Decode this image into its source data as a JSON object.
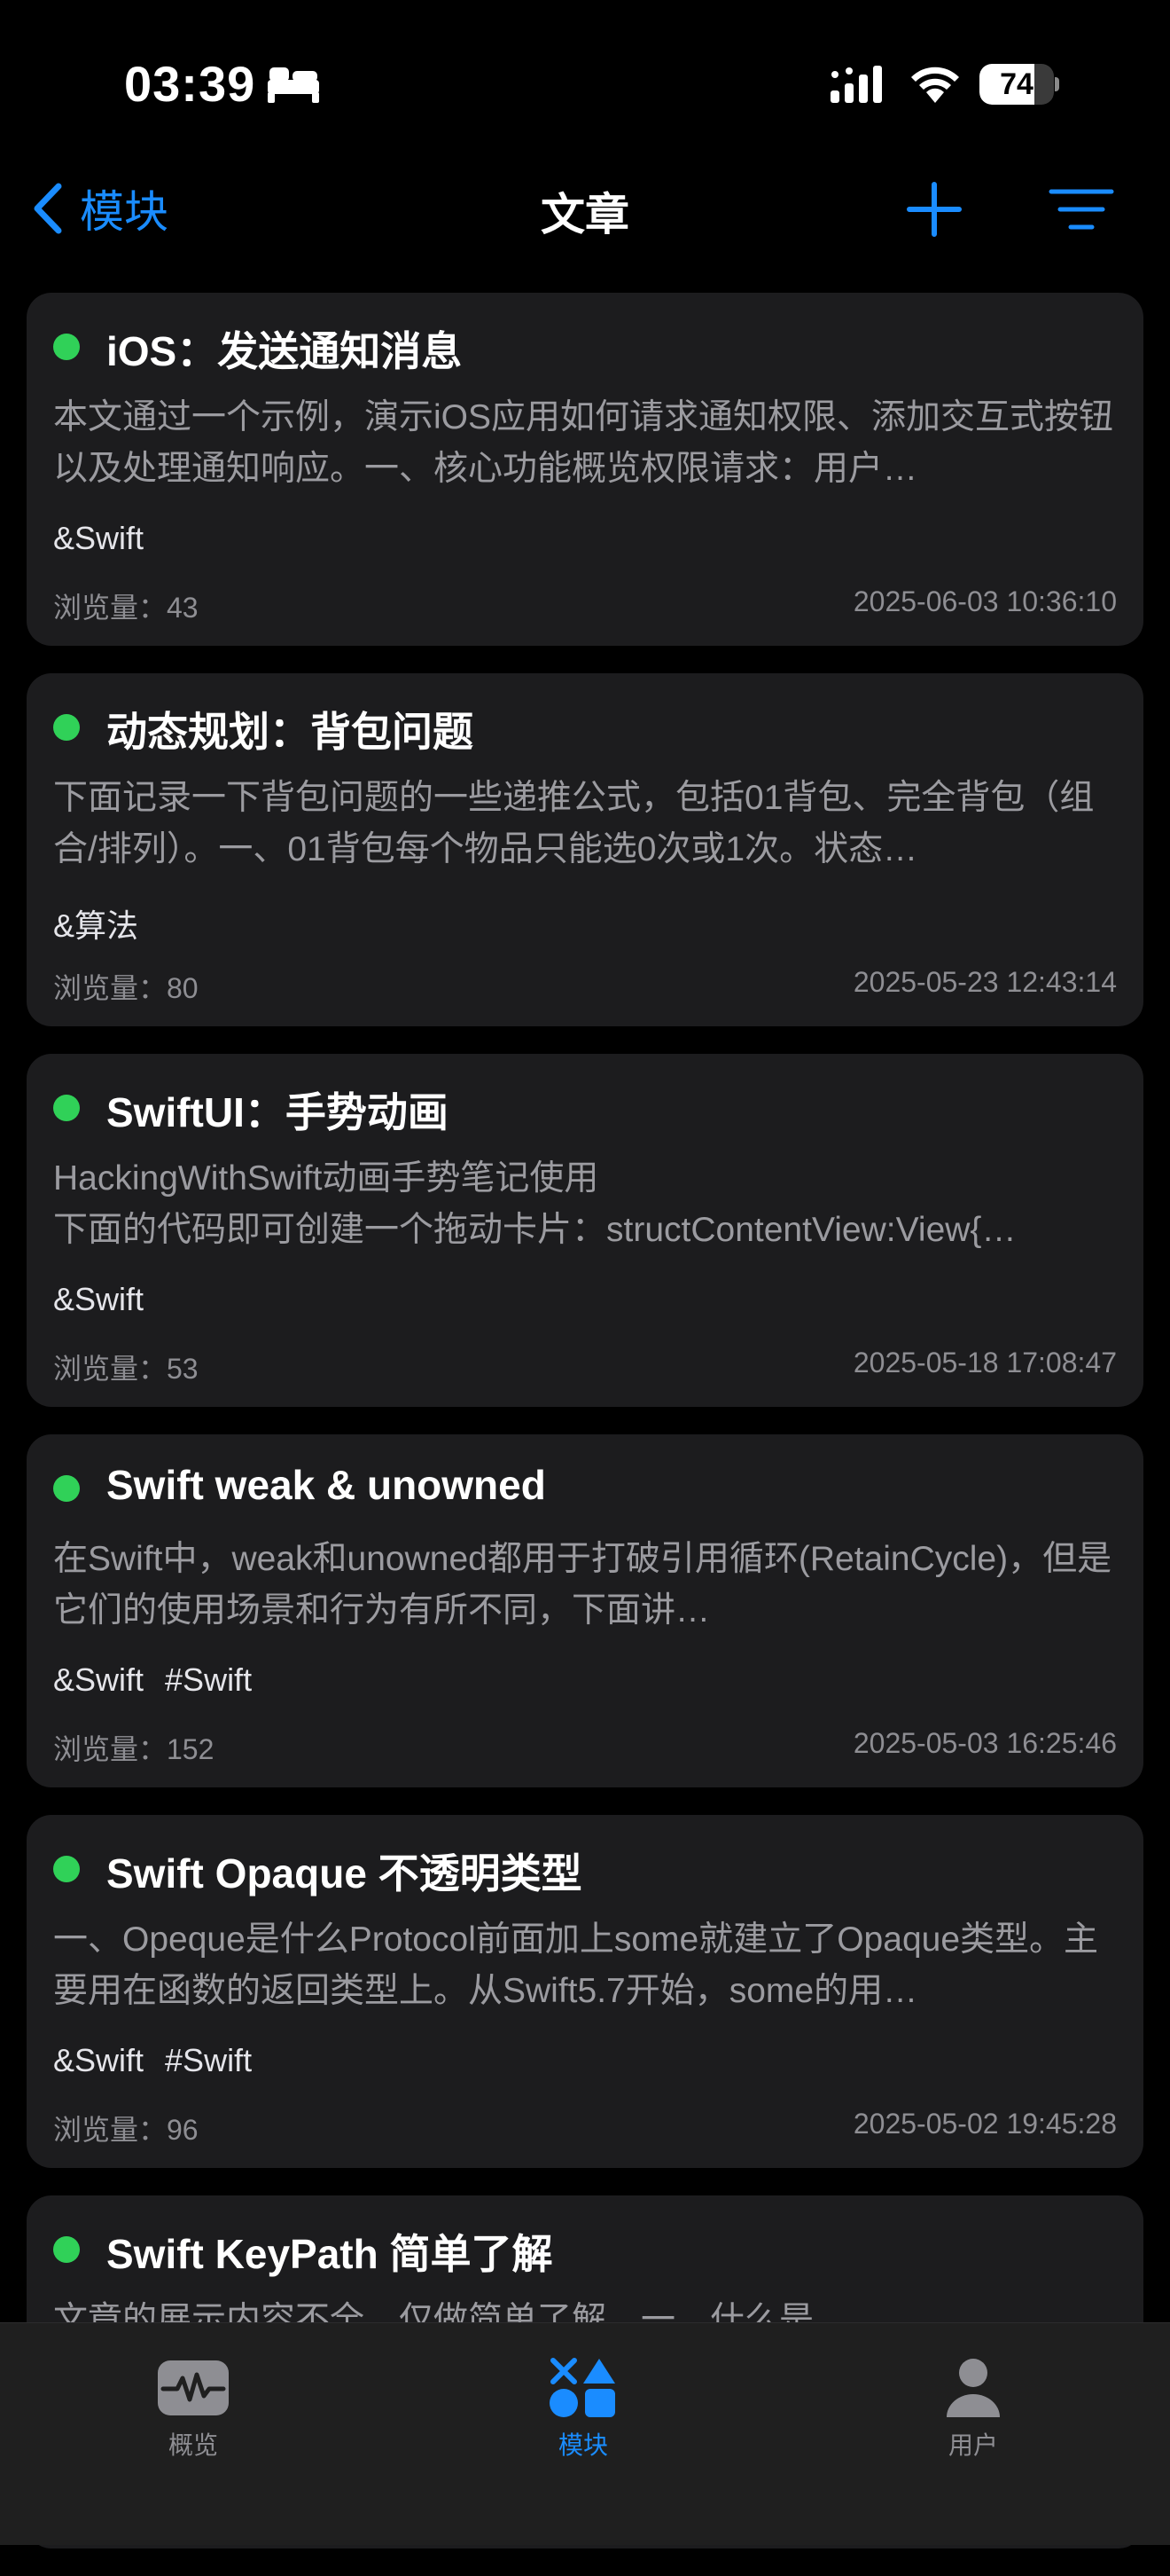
{
  "status_bar": {
    "time": "03:39",
    "battery": "74",
    "battery_level": 0.74,
    "icons": [
      "sleep-icon",
      "cellular-signal-icon",
      "wifi-icon",
      "battery-icon"
    ]
  },
  "nav": {
    "back_label": "模块",
    "title": "文章",
    "actions": [
      "plus-icon",
      "filter-icon"
    ]
  },
  "colors": {
    "accent": "#1a8cff",
    "status_dot": "#30d158",
    "card_bg": "#1c1c1e",
    "background": "#000000"
  },
  "articles": [
    {
      "title": "iOS：发送通知消息",
      "summary": "本文通过一个示例，演示iOS应用如何请求通知权限、添加交互式按钮以及处理通知响应。一、核心功能概览权限请求：用户…",
      "tags": [
        "&Swift"
      ],
      "views": "浏览量：43",
      "date": "2025-06-03 10:36:10"
    },
    {
      "title": "动态规划：背包问题",
      "summary": "下面记录一下背包问题的一些递推公式，包括01背包、完全背包（组合/排列）。一、01背包每个物品只能选0次或1次。状态…",
      "tags": [
        "&算法"
      ],
      "views": "浏览量：80",
      "date": "2025-05-23 12:43:14"
    },
    {
      "title": "SwiftUI：手势动画",
      "summary": "HackingWithSwift动画手势笔记使用\n下面的代码即可创建一个拖动卡片：structContentView:View{…",
      "tags": [
        "&Swift"
      ],
      "views": "浏览量：53",
      "date": "2025-05-18 17:08:47"
    },
    {
      "title": "Swift weak & unowned",
      "summary": "在Swift中，weak和unowned都用于打破引用循环(RetainCycle)，但是它们的使用场景和行为有所不同，下面讲…",
      "tags": [
        "&Swift",
        "#Swift"
      ],
      "views": "浏览量：152",
      "date": "2025-05-03 16:25:46"
    },
    {
      "title": "Swift Opaque 不透明类型",
      "summary": "一、Opeque是什么Protocol前面加上some就建立了Opaque类型。主要用在函数的返回类型上。从Swift5.7开始，some的用…",
      "tags": [
        "&Swift",
        "#Swift"
      ],
      "views": "浏览量：96",
      "date": "2025-05-02 19:45:28"
    },
    {
      "title": "Swift KeyPath 简单了解",
      "summary": "文章的展示内容不全，仅做简单了解。一、什么是",
      "tags": [],
      "views": "",
      "date": ""
    }
  ],
  "tab_bar": {
    "tabs": [
      {
        "label": "概览",
        "icon": "waveform-icon",
        "active": false
      },
      {
        "label": "模块",
        "icon": "shapes-icon",
        "active": true
      },
      {
        "label": "用户",
        "icon": "person-icon",
        "active": false
      }
    ]
  }
}
